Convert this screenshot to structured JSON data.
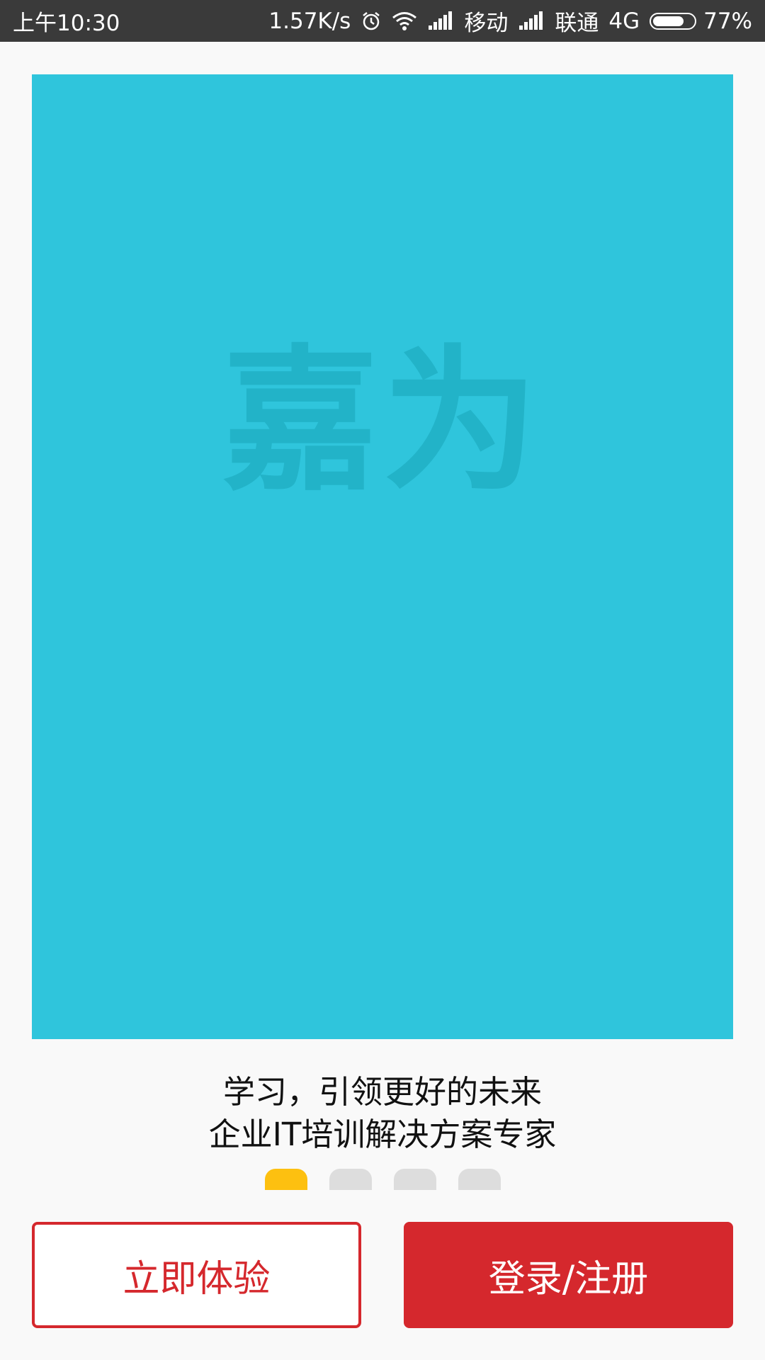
{
  "status_bar": {
    "time": "上午10:30",
    "network_speed": "1.57K/s",
    "carrier1": "移动",
    "carrier2": "联通",
    "network_type": "4G",
    "battery": "77%",
    "battery_level": 0.77,
    "icons": [
      "alarm-icon",
      "wifi-icon",
      "signal-icon",
      "signal-icon",
      "battery-icon"
    ]
  },
  "banner": {
    "logo_text": "嘉为",
    "background_color": "#2fc5dc"
  },
  "slogan": {
    "line1": "学习，引领更好的未来",
    "line2": "企业IT培训解决方案专家"
  },
  "pager": {
    "count": 4,
    "active_index": 0,
    "active_color": "#fdc010"
  },
  "buttons": {
    "try_label": "立即体验",
    "login_label": "登录/注册",
    "accent_color": "#d5282d"
  }
}
